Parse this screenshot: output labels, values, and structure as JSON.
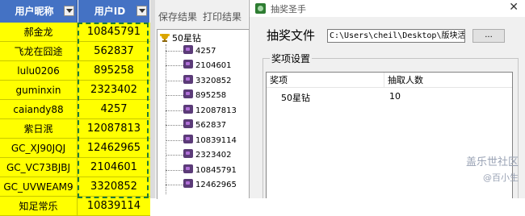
{
  "sheet": {
    "col1_header": "用户昵称",
    "col2_header": "用户ID",
    "rows": [
      {
        "name": "郝金龙",
        "id": "10845791"
      },
      {
        "name": "飞龙在囧途",
        "id": "562837"
      },
      {
        "name": "lulu0206",
        "id": "895258"
      },
      {
        "name": "guminxin",
        "id": "2323402"
      },
      {
        "name": "caiandy88",
        "id": "4257"
      },
      {
        "name": "紫日泯",
        "id": "12087813"
      },
      {
        "name": "GC_XJ90JQJ",
        "id": "12462965"
      },
      {
        "name": "GC_VC73BJBJ",
        "id": "2104601"
      },
      {
        "name": "GC_UVWEAM9",
        "id": "3320852"
      },
      {
        "name": "知足常乐",
        "id": "10839114"
      }
    ],
    "header_color": "#4472c4",
    "cell_color": "#ffff00"
  },
  "middle": {
    "save_label": "保存结果",
    "print_label": "打印结果",
    "tree_root": "50星钻",
    "tree_items": [
      "4257",
      "2104601",
      "3320852",
      "895258",
      "12087813",
      "562837",
      "10839114",
      "2323402",
      "10845791",
      "12462965"
    ],
    "root_icon": "trophy-icon",
    "item_icon": "gem-icon"
  },
  "dialog": {
    "title": "抽奖圣手",
    "close": "✕",
    "file_label": "抽奖文件",
    "file_path": "C:\\Users\\cheil\\Desktop\\版块活",
    "browse_label": "...",
    "group_label": "奖项设置",
    "list_headers": [
      "奖项",
      "抽取人数"
    ],
    "list_rows": [
      {
        "prize": "50星钻",
        "count": "10"
      }
    ],
    "app_icon": "app-icon"
  },
  "watermark": {
    "line1": "盖乐世社区",
    "line2": "@百小生"
  }
}
